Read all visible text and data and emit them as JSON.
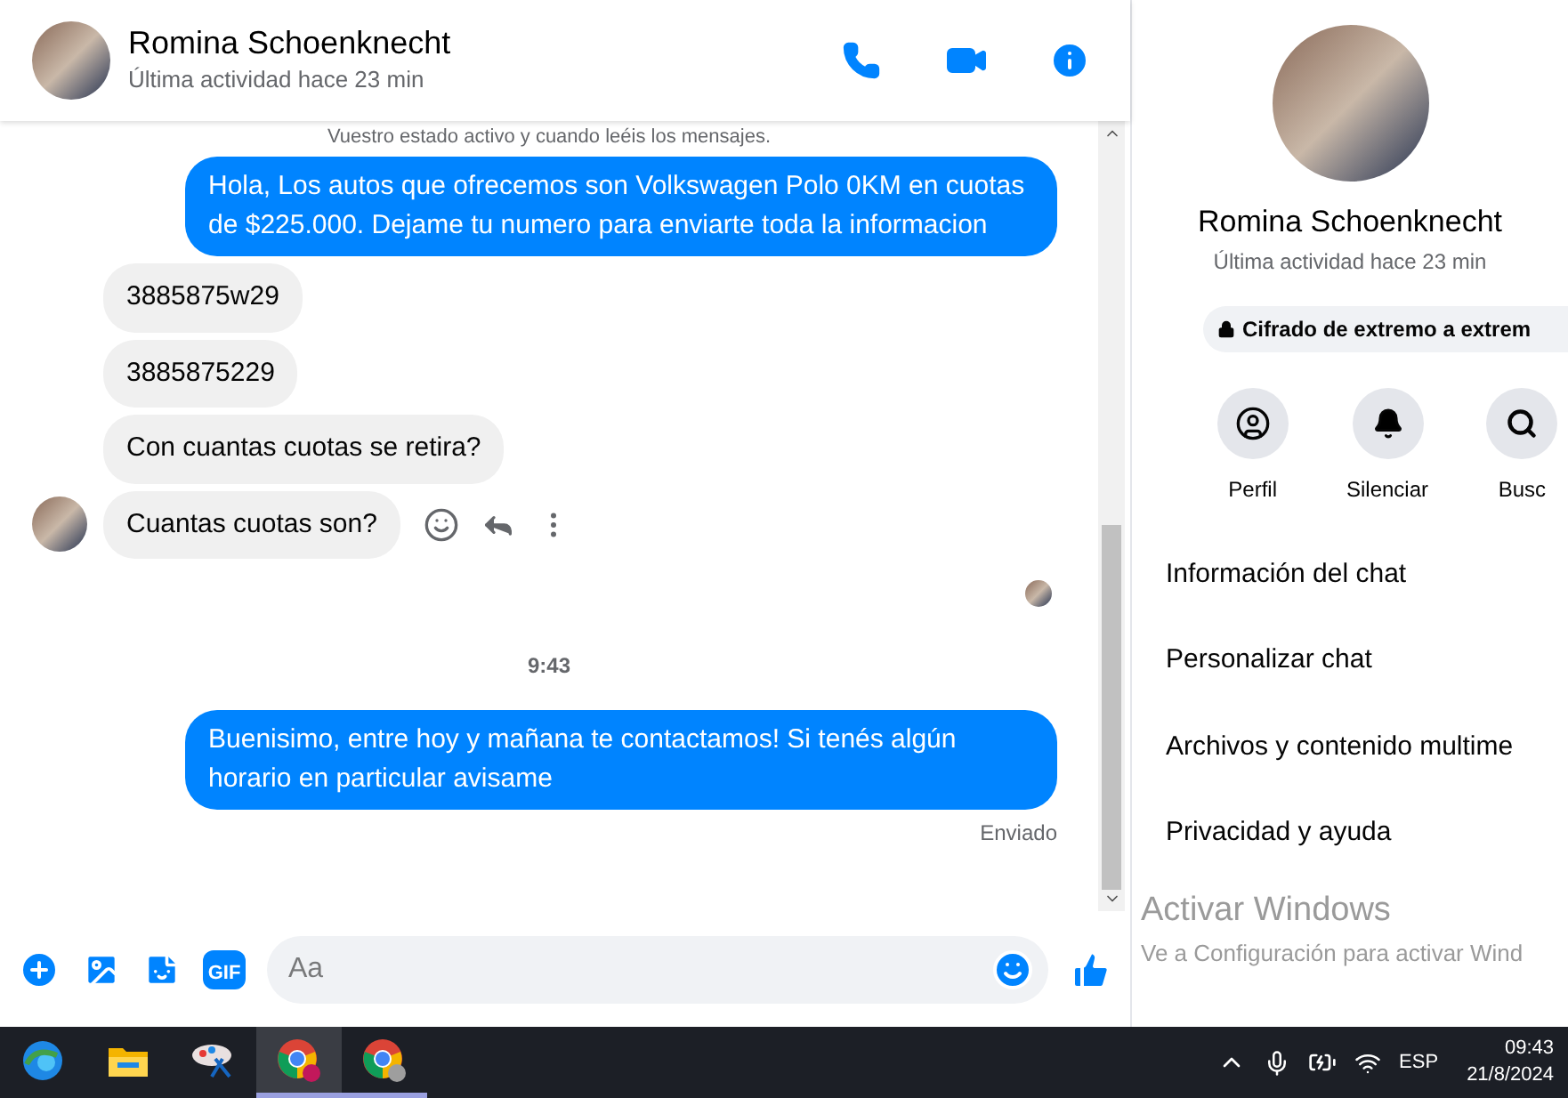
{
  "header": {
    "name": "Romina Schoenknecht",
    "status": "Última actividad hace 23 min"
  },
  "messages": [
    {
      "kind": "notice",
      "text": "Vuestro estado activo y cuando leéis los mensajes."
    },
    {
      "kind": "outgoing",
      "text": "Hola, Los autos que ofrecemos son Volkswagen Polo 0KM en cuotas de $225.000. Dejame tu numero para enviarte toda la informacion"
    },
    {
      "kind": "incoming",
      "text": "3885875w29",
      "avatar": false,
      "hovered": false
    },
    {
      "kind": "incoming",
      "text": "3885875229",
      "avatar": false,
      "hovered": false
    },
    {
      "kind": "incoming",
      "text": "Con cuantas cuotas se retira?",
      "avatar": false,
      "hovered": false
    },
    {
      "kind": "incoming",
      "text": "Cuantas cuotas son?",
      "avatar": true,
      "hovered": true
    },
    {
      "kind": "seen"
    },
    {
      "kind": "time",
      "text": "9:43"
    },
    {
      "kind": "outgoing",
      "text": "Buenisimo, entre hoy y mañana te contactamos! Si tenés algún horario en particular avisame"
    },
    {
      "kind": "status",
      "text": "Enviado"
    }
  ],
  "composer": {
    "placeholder": "Aa",
    "gif_label": "GIF"
  },
  "panel": {
    "name": "Romina Schoenknecht",
    "status": "Última actividad hace 23 min",
    "encryption": "Cifrado de extremo a extrem",
    "actions": [
      {
        "kind": "profile",
        "label": "Perfil"
      },
      {
        "kind": "mute",
        "label": "Silenciar"
      },
      {
        "kind": "search",
        "label": "Busc"
      }
    ],
    "menu": [
      "Información del chat",
      "Personalizar chat",
      "Archivos y contenido multime",
      "Privacidad y ayuda"
    ]
  },
  "activation": {
    "title": "Activar Windows",
    "subtitle": "Ve a Configuración para activar Wind"
  },
  "taskbar": {
    "apps": [
      {
        "kind": "edge",
        "selected": false,
        "open": false
      },
      {
        "kind": "folder",
        "selected": false,
        "open": false
      },
      {
        "kind": "paint",
        "selected": false,
        "open": false
      },
      {
        "kind": "chrome",
        "selected": true,
        "open": true
      },
      {
        "kind": "chrome-profile",
        "selected": false,
        "open": true
      }
    ],
    "language": "ESP",
    "time": "09:43",
    "date": "21/8/2024"
  }
}
